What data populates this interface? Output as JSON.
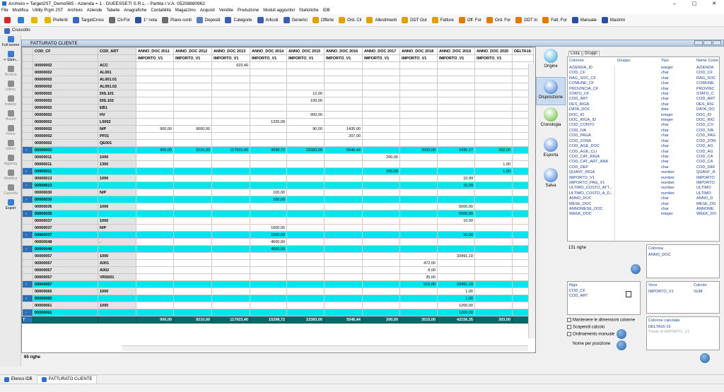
{
  "window": {
    "title": "Archivio = Target2ST_Demo565 - Azienda = 1 - DUEESSETI S.R.L. - Partita I.V.A. 05208880962",
    "min": "–",
    "max": "▢",
    "close": "✕"
  },
  "menu": [
    "File",
    "Modifica",
    "Utility Prgm 2ST",
    "Archivio",
    "Aziende",
    "Tabelle",
    "Anagrafiche",
    "Contabilità",
    "Magazzino",
    "Acquisti",
    "Vendite",
    "Produzione",
    "Moduli aggiuntivi",
    "Statistiche",
    "IDB"
  ],
  "toolbar": [
    {
      "label": "",
      "color": "#d62828"
    },
    {
      "label": "",
      "color": "#2f7fd8"
    },
    {
      "label": "",
      "color": "#e6b800"
    },
    {
      "label": "Preferiti",
      "color": "#e8b400"
    },
    {
      "label": "TargetCross",
      "color": "#3a66c4"
    },
    {
      "label": "Cli-For",
      "color": "#6b6b6b"
    },
    {
      "label": "1° nota",
      "color": "#304f9a"
    },
    {
      "label": "Piano conti",
      "color": "#6b6b6b"
    },
    {
      "label": "Depositi",
      "color": "#5a7dbf"
    },
    {
      "label": "Categorie",
      "color": "#3b5fb0"
    },
    {
      "label": "Articoli",
      "color": "#3b5fb0"
    },
    {
      "label": "Generici",
      "color": "#3b5fb0"
    },
    {
      "label": "Offerte",
      "color": "#e2a000"
    },
    {
      "label": "Ord. Cli",
      "color": "#e2a000"
    },
    {
      "label": "Allestimenti",
      "color": "#e2a000"
    },
    {
      "label": "DDT Out",
      "color": "#e2a000"
    },
    {
      "label": "Fatture",
      "color": "#e2a000"
    },
    {
      "label": "Off. For",
      "color": "#e07a00"
    },
    {
      "label": "Ord. For",
      "color": "#e07a00"
    },
    {
      "label": "DDT In",
      "color": "#e07a00"
    },
    {
      "label": "Fatt. For",
      "color": "#e07a00"
    },
    {
      "label": "Manuale",
      "color": "#2b4f9e"
    },
    {
      "label": "Mastrini",
      "color": "#2b4f9e"
    }
  ],
  "cruscotto": "Cruscotto",
  "leftrail": [
    {
      "label": "Full screen",
      "on": true
    },
    {
      "label": "-> Stam...",
      "on": true
    },
    {
      "label": "Ricerca",
      "on": false
    },
    {
      "label": "Ultimo",
      "on": false
    },
    {
      "label": "Indietro",
      "on": false
    },
    {
      "label": "Avanti",
      "on": false
    },
    {
      "label": "Primo",
      "on": false
    },
    {
      "label": "Ultimo",
      "on": false
    },
    {
      "label": "Aggiung",
      "on": false
    },
    {
      "label": "Modifica",
      "on": false
    },
    {
      "label": "Cancella",
      "on": false
    },
    {
      "label": "Export",
      "on": true
    }
  ],
  "child_window": {
    "title": "FATTURATO CLIENTE"
  },
  "grid": {
    "headers": [
      "COD_CF",
      "COD_ART",
      "ANNO_DOC 2011",
      "ANNO_DOC 2012",
      "ANNO_DOC 2013",
      "ANNO_DOC 2014",
      "ANNO_DOC 2015",
      "ANNO_DOC 2016",
      "ANNO_DOC 2017",
      "ANNO_DOC 2018",
      "ANNO_DOC 2019",
      "ANNO_DOC 2020",
      "DELTA16-"
    ],
    "subheader": "IMPORTO_V1",
    "rows": [
      {
        "cf": "00000002",
        "art": "ACC",
        "v": [
          "",
          "",
          "923,40",
          "",
          "",
          "",
          "",
          "",
          "",
          "",
          ""
        ],
        "sub": false
      },
      {
        "cf": "00000002",
        "art": "AL001",
        "v": [
          "",
          "",
          "",
          "",
          "",
          "",
          "",
          "",
          "",
          "",
          ""
        ],
        "sub": false
      },
      {
        "cf": "00000002",
        "art": "AL001.01",
        "v": [
          "",
          "",
          "",
          "",
          "",
          "",
          "",
          "",
          "",
          "",
          ""
        ],
        "sub": false
      },
      {
        "cf": "00000002",
        "art": "AL001.02",
        "v": [
          "",
          "",
          "",
          "",
          "",
          "",
          "",
          "",
          "",
          "",
          ""
        ],
        "sub": false
      },
      {
        "cf": "00000002",
        "art": "DIS.101",
        "v": [
          "",
          "",
          "",
          "",
          "12,00",
          "",
          "",
          "",
          "",
          "",
          ""
        ],
        "sub": false
      },
      {
        "cf": "00000002",
        "art": "DIS.102",
        "v": [
          "",
          "",
          "",
          "",
          "100,00",
          "",
          "",
          "",
          "",
          "",
          ""
        ],
        "sub": false
      },
      {
        "cf": "00000002",
        "art": "EB1",
        "v": [
          "",
          "",
          "",
          "",
          "",
          "",
          "",
          "",
          "",
          "",
          ""
        ],
        "sub": false
      },
      {
        "cf": "00000002",
        "art": "HV",
        "v": [
          "",
          "",
          "",
          "",
          "900,00",
          "",
          "",
          "",
          "",
          "",
          ""
        ],
        "sub": false
      },
      {
        "cf": "00000002",
        "art": "L0002",
        "v": [
          "",
          "",
          "",
          "1325,09",
          "",
          "",
          "",
          "",
          "",
          "",
          ""
        ],
        "sub": false
      },
      {
        "cf": "00000002",
        "art": "N/P",
        "v": [
          "900,00",
          "9000,00",
          "",
          "",
          "90,00",
          "1435,00",
          "",
          "",
          "",
          "",
          ""
        ],
        "sub": false
      },
      {
        "cf": "00000002",
        "art": "PF01",
        "v": [
          "",
          "",
          "",
          "",
          "",
          "207,00",
          "",
          "",
          "",
          "",
          ""
        ],
        "sub": false
      },
      {
        "cf": "00000002",
        "art": "QE001",
        "v": [
          "",
          "",
          "",
          "",
          "",
          "",
          "",
          "",
          "",
          "",
          ""
        ],
        "sub": false
      },
      {
        "cf": "00000002",
        "art": "",
        "v": [
          "900,00",
          "9210,00",
          "117923,40",
          "9698,72",
          "22383,00",
          "5546,44",
          "",
          "3000,00",
          "2435,17",
          "302,00",
          ""
        ],
        "sub": true
      },
      {
        "cf": "00000011",
        "art": "1000",
        "v": [
          "",
          "",
          "",
          "",
          "",
          "",
          "200,00",
          "",
          "",
          "",
          ""
        ],
        "sub": false
      },
      {
        "cf": "00000011",
        "art": "1300",
        "v": [
          "",
          "",
          "",
          "",
          "",
          "",
          "",
          "",
          "",
          "1,00",
          ""
        ],
        "sub": false
      },
      {
        "cf": "00000011",
        "art": "",
        "v": [
          "",
          "",
          "",
          "",
          "",
          "",
          "200,00",
          "",
          "",
          "1,00",
          ""
        ],
        "sub": true
      },
      {
        "cf": "00000013",
        "art": "1000",
        "v": [
          "",
          "",
          "",
          "",
          "",
          "",
          "",
          "",
          "10,99",
          "",
          ""
        ],
        "sub": false
      },
      {
        "cf": "00000013",
        "art": "",
        "v": [
          "",
          "",
          "",
          "",
          "",
          "",
          "",
          "",
          "10,99",
          "",
          ""
        ],
        "sub": true
      },
      {
        "cf": "00000030",
        "art": "N/P",
        "v": [
          "",
          "",
          "",
          "100,00",
          "",
          "",
          "",
          "",
          "",
          "",
          ""
        ],
        "sub": false
      },
      {
        "cf": "00000030",
        "art": "",
        "v": [
          "",
          "",
          "",
          "100,00",
          "",
          "",
          "",
          "",
          "",
          "",
          ""
        ],
        "sub": true
      },
      {
        "cf": "00000035",
        "art": "1000",
        "v": [
          "",
          "",
          "",
          "",
          "",
          "",
          "",
          "",
          "5000,00",
          "",
          ""
        ],
        "sub": false
      },
      {
        "cf": "00000035",
        "art": "",
        "v": [
          "",
          "",
          "",
          "",
          "",
          "",
          "",
          "",
          "5000,00",
          "",
          ""
        ],
        "sub": true
      },
      {
        "cf": "00000037",
        "art": "1000",
        "v": [
          "",
          "",
          "",
          "",
          "",
          "",
          "",
          "",
          "10,00",
          "",
          ""
        ],
        "sub": false
      },
      {
        "cf": "00000037",
        "art": "N/P",
        "v": [
          "",
          "",
          "",
          "1000,00",
          "",
          "",
          "",
          "",
          "",
          "",
          ""
        ],
        "sub": false
      },
      {
        "cf": "00000037",
        "art": "",
        "v": [
          "",
          "",
          "",
          "1000,00",
          "",
          "",
          "",
          "",
          "10,00",
          "",
          ""
        ],
        "sub": true
      },
      {
        "cf": "00000048",
        "art": ".",
        "v": [
          "",
          "",
          "",
          "4500,00",
          "",
          "",
          "",
          "",
          "",
          "",
          ""
        ],
        "sub": false
      },
      {
        "cf": "00000048",
        "art": "",
        "v": [
          "",
          "",
          "",
          "4500,00",
          "",
          "",
          "",
          "",
          "",
          "",
          ""
        ],
        "sub": true
      },
      {
        "cf": "00000057",
        "art": "1000",
        "v": [
          "",
          "",
          "",
          "",
          "",
          "",
          "",
          "",
          "33491,19",
          "",
          ""
        ],
        "sub": false
      },
      {
        "cf": "00000057",
        "art": "A001",
        "v": [
          "",
          "",
          "",
          "",
          "",
          "",
          "",
          "472,00",
          "",
          "",
          ""
        ],
        "sub": false
      },
      {
        "cf": "00000057",
        "art": "A002",
        "v": [
          "",
          "",
          "",
          "",
          "",
          "",
          "",
          "8,00",
          "",
          "",
          ""
        ],
        "sub": false
      },
      {
        "cf": "00000057",
        "art": "VRS001",
        "v": [
          "",
          "",
          "",
          "",
          "",
          "",
          "",
          "35,00",
          "",
          "",
          ""
        ],
        "sub": false
      },
      {
        "cf": "00000057",
        "art": "",
        "v": [
          "",
          "",
          "",
          "",
          "",
          "",
          "",
          "515,00",
          "33491,19",
          "",
          ""
        ],
        "sub": true
      },
      {
        "cf": "00000060",
        "art": "1000",
        "v": [
          "",
          "",
          "",
          "",
          "",
          "",
          "",
          "",
          "1,00",
          "",
          ""
        ],
        "sub": false
      },
      {
        "cf": "00000060",
        "art": "",
        "v": [
          "",
          "",
          "",
          "",
          "",
          "",
          "",
          "",
          "1,00",
          "",
          ""
        ],
        "sub": true
      },
      {
        "cf": "00000061",
        "art": "1000",
        "v": [
          "",
          "",
          "",
          "",
          "",
          "",
          "",
          "",
          "1200,00",
          "",
          ""
        ],
        "sub": false
      },
      {
        "cf": "00000061",
        "art": "",
        "v": [
          "",
          "",
          "",
          "",
          "",
          "",
          "",
          "",
          "1200,00",
          "",
          ""
        ],
        "sub": true
      }
    ],
    "totals": [
      "900,00",
      "9210,00",
      "117923,40",
      "15298,72",
      "22383,00",
      "5546,44",
      "200,00",
      "3515,00",
      "42156,35",
      "303,00",
      ""
    ],
    "row_count": "65 righe"
  },
  "side_buttons": [
    {
      "label": "Origine",
      "color": "#2a9fd6"
    },
    {
      "label": "Disposizione",
      "color": "#2a6fd0"
    },
    {
      "label": "Cronologia",
      "color": "#5cb82e"
    },
    {
      "label": "Esporta",
      "color": "#2a6fd0"
    },
    {
      "label": "Salva",
      "color": "#2a6fd0"
    }
  ],
  "right": {
    "tabs": [
      "Lista",
      "Gruppi"
    ],
    "col_headers": [
      "Colonne",
      "Gruppo",
      "Tipo",
      "Nome Colon"
    ],
    "columns": [
      "AZIENDA_ID",
      "COD_CF",
      "RAG_SOC_CF",
      "COMUNE_CF",
      "PROVINCIA_CF",
      "STATO_CF",
      "COD_ART",
      "DES_RIGA",
      "DATA_DOC",
      "DOC_ID",
      "DOC_RIGA_ID",
      "COD_CONTO",
      "COD_IVA",
      "COD_PAGA",
      "COD_ZONA",
      "COD_AGE_DOC",
      "COD_AGE_CLI",
      "COD_CAT_RIGA",
      "COD_CAT_ART_ANA",
      "COD_DEP",
      "QUANT_RIGA",
      "IMPORTO_V1",
      "IMPORTO_PAG_V1",
      "ULTIMO_COSTO_ATT...",
      "ULTIMO_COSTO_A_D...",
      "ANNO_DOC",
      "MESE_DOC",
      "ANNOMESE_DOC",
      "WEEK_DOC"
    ],
    "types": [
      "integer",
      "char",
      "char",
      "char",
      "char",
      "char",
      "char",
      "char",
      "date",
      "integer",
      "integer",
      "char",
      "char",
      "char",
      "char",
      "char",
      "char",
      "char",
      "char",
      "char",
      "number",
      "number",
      "number",
      "number",
      "number",
      "char",
      "char",
      "char",
      "integer"
    ],
    "names": [
      "AZIENDA",
      "COD_CF",
      "RAG_SOC",
      "COMUNE",
      "PROVINC",
      "STATO_C",
      "COD_ART",
      "DES_RIG",
      "DATA_DO",
      "DOC_ID",
      "DOC_RIG",
      "COD_CO",
      "COD_IVA",
      "COD_PAG",
      "COD_ZON",
      "COD_AG",
      "COD_AG",
      "COD_CA",
      "COD_CA",
      "COD_DEF",
      "QUANT_R",
      "IMPORTO",
      "IMPORTO",
      "ULTIMO",
      "ULTIMO",
      "ANNO_D",
      "MESE_DO",
      "ANNOME",
      "WEEK_DO"
    ],
    "righe_count": "131 righe",
    "colonna_label": "Colonna",
    "colonna_value": "ANNO_DOC",
    "riga_label": "Riga",
    "riga_values": [
      "COD_CF",
      "COD_ART"
    ],
    "voce_label": "Voce",
    "voce_value": "IMPORTO_V1",
    "calcolo_label": "Calcolo",
    "calcolo_value": "SUM",
    "checks": [
      "Mantenere le dimensioni colonne",
      "Scapendi calcolo",
      "Ordinamento manuale"
    ],
    "nome_pos": "Nome per posizione",
    "calc_label": "Colonne calcolate",
    "calc_value": "DELTA16-15",
    "calc_sub": "Totale di IMPORTO_V1"
  },
  "taskbar": [
    "Elenco iDB",
    "FATTURATO CLIENTE"
  ]
}
